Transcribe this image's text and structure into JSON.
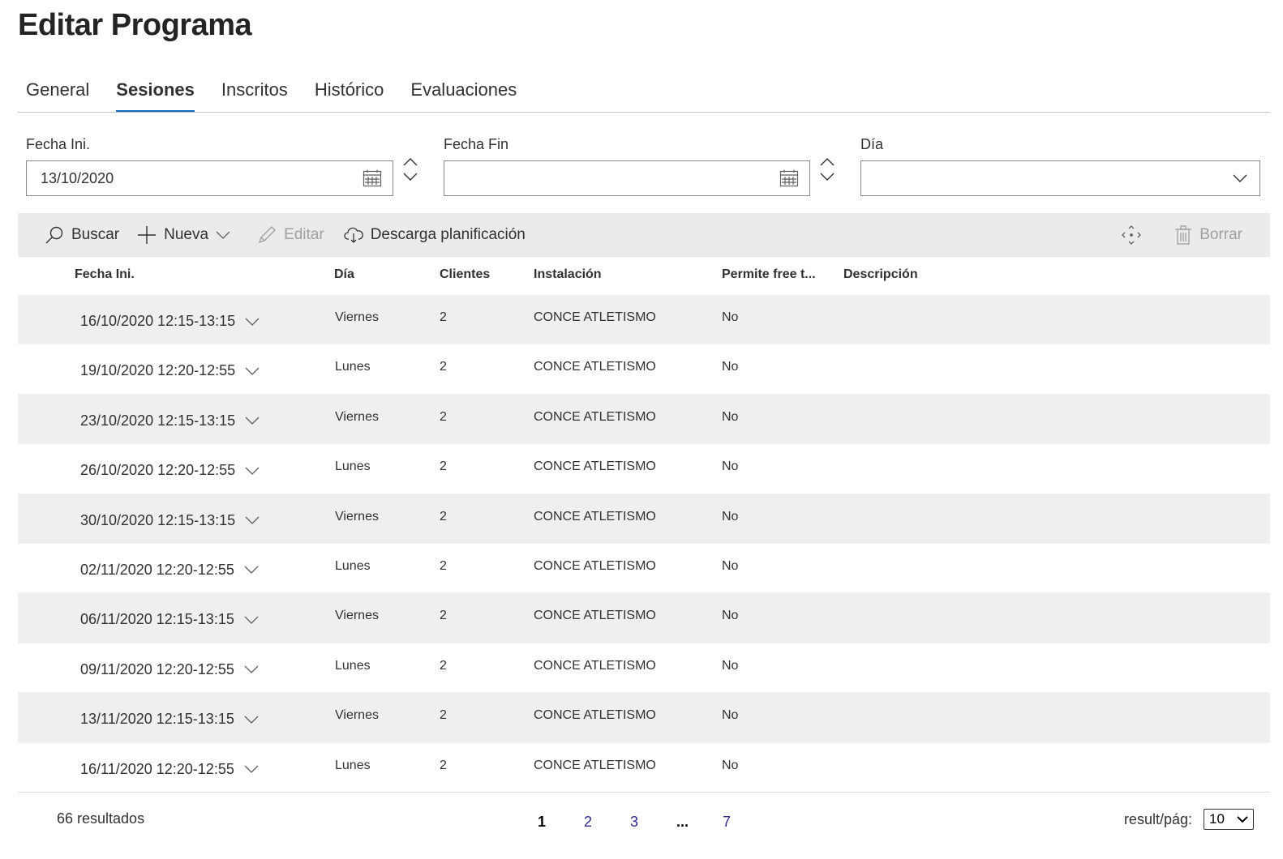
{
  "page": {
    "title": "Editar Programa"
  },
  "tabs": [
    {
      "label": "General"
    },
    {
      "label": "Sesiones"
    },
    {
      "label": "Inscritos"
    },
    {
      "label": "Histórico"
    },
    {
      "label": "Evaluaciones"
    }
  ],
  "active_tab": "Sesiones",
  "filters": {
    "fecha_ini": {
      "label": "Fecha Ini.",
      "value": "13/10/2020"
    },
    "fecha_fin": {
      "label": "Fecha Fin",
      "value": ""
    },
    "dia": {
      "label": "Día",
      "value": ""
    }
  },
  "toolbar": {
    "buscar": "Buscar",
    "nueva": "Nueva",
    "editar": "Editar",
    "descarga": "Descarga planificación",
    "borrar": "Borrar"
  },
  "table": {
    "headers": [
      "Fecha Ini.",
      "Día",
      "Clientes",
      "Instalación",
      "Permite free t...",
      "Descripción"
    ],
    "rows": [
      {
        "fecha": "16/10/2020 12:15-13:15",
        "dia": "Viernes",
        "clientes": "2",
        "instalacion": "CONCE ATLETISMO",
        "free": "No",
        "descripcion": ""
      },
      {
        "fecha": "19/10/2020 12:20-12:55",
        "dia": "Lunes",
        "clientes": "2",
        "instalacion": "CONCE ATLETISMO",
        "free": "No",
        "descripcion": ""
      },
      {
        "fecha": "23/10/2020 12:15-13:15",
        "dia": "Viernes",
        "clientes": "2",
        "instalacion": "CONCE ATLETISMO",
        "free": "No",
        "descripcion": ""
      },
      {
        "fecha": "26/10/2020 12:20-12:55",
        "dia": "Lunes",
        "clientes": "2",
        "instalacion": "CONCE ATLETISMO",
        "free": "No",
        "descripcion": ""
      },
      {
        "fecha": "30/10/2020 12:15-13:15",
        "dia": "Viernes",
        "clientes": "2",
        "instalacion": "CONCE ATLETISMO",
        "free": "No",
        "descripcion": ""
      },
      {
        "fecha": "02/11/2020 12:20-12:55",
        "dia": "Lunes",
        "clientes": "2",
        "instalacion": "CONCE ATLETISMO",
        "free": "No",
        "descripcion": ""
      },
      {
        "fecha": "06/11/2020 12:15-13:15",
        "dia": "Viernes",
        "clientes": "2",
        "instalacion": "CONCE ATLETISMO",
        "free": "No",
        "descripcion": ""
      },
      {
        "fecha": "09/11/2020 12:20-12:55",
        "dia": "Lunes",
        "clientes": "2",
        "instalacion": "CONCE ATLETISMO",
        "free": "No",
        "descripcion": ""
      },
      {
        "fecha": "13/11/2020 12:15-13:15",
        "dia": "Viernes",
        "clientes": "2",
        "instalacion": "CONCE ATLETISMO",
        "free": "No",
        "descripcion": ""
      },
      {
        "fecha": "16/11/2020 12:20-12:55",
        "dia": "Lunes",
        "clientes": "2",
        "instalacion": "CONCE ATLETISMO",
        "free": "No",
        "descripcion": ""
      }
    ]
  },
  "footer": {
    "results": "66 resultados",
    "pages": [
      "1",
      "2",
      "3",
      "...",
      "7"
    ],
    "current_page": "1",
    "per_page_label": "result/pág:",
    "per_page_value": "10"
  },
  "colors": {
    "accent": "#0f6cbd",
    "toolbar_bg": "#ebebeb",
    "row_alt_bg": "#efefef",
    "disabled": "#a19f9d"
  }
}
